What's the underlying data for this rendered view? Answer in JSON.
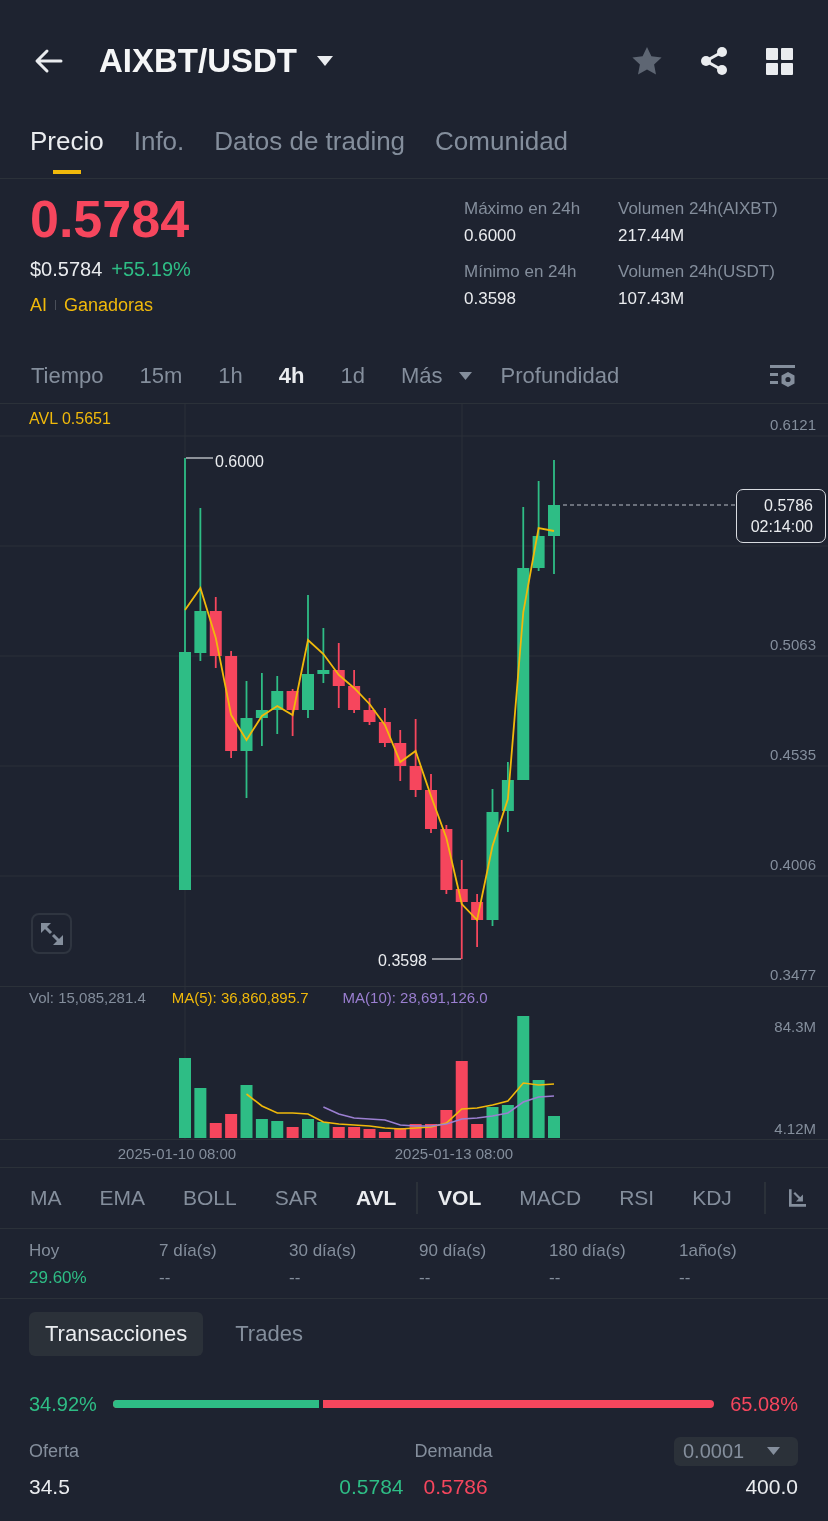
{
  "header": {
    "title": "AIXBT/USDT",
    "favorite": false
  },
  "tabs": [
    {
      "label": "Precio",
      "selected": true
    },
    {
      "label": "Info.",
      "selected": false
    },
    {
      "label": "Datos de trading",
      "selected": false
    },
    {
      "label": "Comunidad",
      "selected": false
    }
  ],
  "ticker": {
    "last_price": "0.5784",
    "last_price_up": false,
    "usd_price": "$0.5784",
    "change": "+55.19%",
    "change_up": true,
    "tags": [
      "AI",
      "Ganadoras"
    ],
    "stats": [
      {
        "label": "Máximo en 24h",
        "value": "0.6000"
      },
      {
        "label": "Volumen 24h(AIXBT)",
        "value": "217.44M"
      },
      {
        "label": "Mínimo en 24h",
        "value": "0.3598"
      },
      {
        "label": "Volumen 24h(USDT)",
        "value": "107.43M"
      }
    ]
  },
  "intervals": [
    {
      "label": "Tiempo",
      "kind": "option",
      "selected": false
    },
    {
      "label": "15m",
      "kind": "option",
      "selected": false
    },
    {
      "label": "1h",
      "kind": "option",
      "selected": false
    },
    {
      "label": "4h",
      "kind": "option",
      "selected": true
    },
    {
      "label": "1d",
      "kind": "option",
      "selected": false
    },
    {
      "label": "Más",
      "kind": "dropdown",
      "selected": false
    },
    {
      "label": "Profundidad",
      "kind": "option",
      "selected": false
    }
  ],
  "chart": {
    "avl_label": "AVL 0.5651",
    "price_ticks": [
      "0.6121",
      "0.5063",
      "0.4535",
      "0.4006",
      "0.3477"
    ],
    "high_marker": "0.6000",
    "low_marker": "0.3598",
    "last_price": "0.5786",
    "countdown": "02:14:00"
  },
  "volume": {
    "vol": "Vol: 15,085,281.4",
    "ma5": "MA(5): 36,860,895.7",
    "ma10": "MA(10): 28,691,126.0",
    "ticks": [
      "84.3M",
      "4.12M"
    ],
    "dates": [
      "2025-01-10 08:00",
      "2025-01-13 08:00"
    ]
  },
  "main_indicators": [
    {
      "label": "MA",
      "selected": false
    },
    {
      "label": "EMA",
      "selected": false
    },
    {
      "label": "BOLL",
      "selected": false
    },
    {
      "label": "SAR",
      "selected": false
    },
    {
      "label": "AVL",
      "selected": true
    }
  ],
  "sub_indicators": [
    {
      "label": "VOL",
      "selected": true
    },
    {
      "label": "MACD",
      "selected": false
    },
    {
      "label": "RSI",
      "selected": false
    },
    {
      "label": "KDJ",
      "selected": false
    }
  ],
  "performance": [
    {
      "label": "Hoy",
      "value": "29.60%",
      "positive": true
    },
    {
      "label": "7 día(s)",
      "value": "--",
      "positive": false
    },
    {
      "label": "30 día(s)",
      "value": "--",
      "positive": false
    },
    {
      "label": "90 día(s)",
      "value": "--",
      "positive": false
    },
    {
      "label": "180 día(s)",
      "value": "--",
      "positive": false
    },
    {
      "label": "1año(s)",
      "value": "--",
      "positive": false
    }
  ],
  "trade_tabs": [
    {
      "label": "Transacciones",
      "selected": true
    },
    {
      "label": "Trades",
      "selected": false
    }
  ],
  "ratio": {
    "buy": "34.92%",
    "sell": "65.08%",
    "level": 0.3492
  },
  "order_book": {
    "bid_label": "Oferta",
    "ask_label": "Demanda",
    "precision": "0.0001",
    "rows": [
      {
        "bid_qty": "34.5",
        "bid_price": "0.5784",
        "ask_price": "0.5786",
        "ask_qty": "400.0"
      }
    ]
  }
}
